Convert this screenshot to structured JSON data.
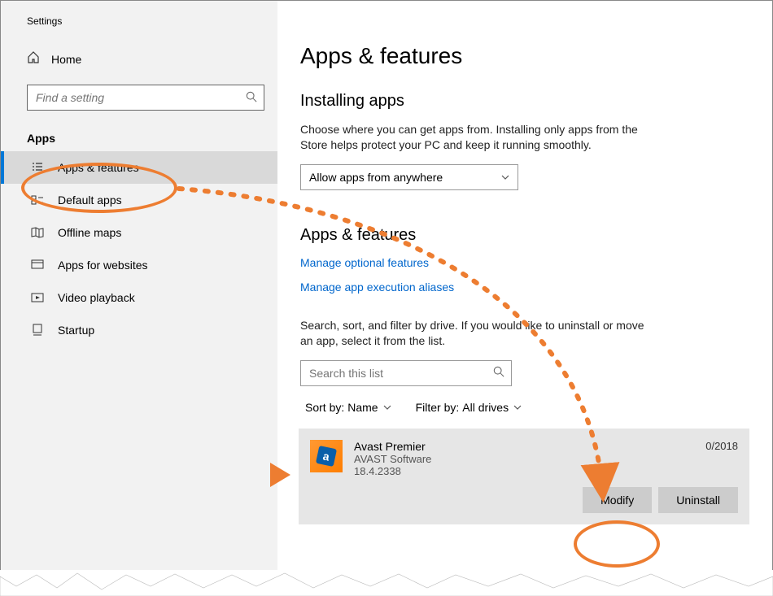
{
  "sidebar": {
    "window_title": "Settings",
    "home_label": "Home",
    "search_placeholder": "Find a setting",
    "section_label": "Apps",
    "items": [
      {
        "label": "Apps & features"
      },
      {
        "label": "Default apps"
      },
      {
        "label": "Offline maps"
      },
      {
        "label": "Apps for websites"
      },
      {
        "label": "Video playback"
      },
      {
        "label": "Startup"
      }
    ]
  },
  "main": {
    "title": "Apps & features",
    "section1_heading": "Installing apps",
    "section1_desc": "Choose where you can get apps from. Installing only apps from the Store helps protect your PC and keep it running smoothly.",
    "install_source": "Allow apps from anywhere",
    "section2_heading": "Apps & features",
    "link_optional": "Manage optional features",
    "link_aliases": "Manage app execution aliases",
    "list_desc": "Search, sort, and filter by drive. If you would like to uninstall or move an app, select it from the list.",
    "list_search_placeholder": "Search this list",
    "sort_label": "Sort by:",
    "sort_value": "Name",
    "filter_label": "Filter by:",
    "filter_value": "All drives",
    "app": {
      "name": "Avast Premier",
      "publisher": "AVAST Software",
      "version": "18.4.2338",
      "date": "0/2018",
      "modify_label": "Modify",
      "uninstall_label": "Uninstall"
    }
  }
}
